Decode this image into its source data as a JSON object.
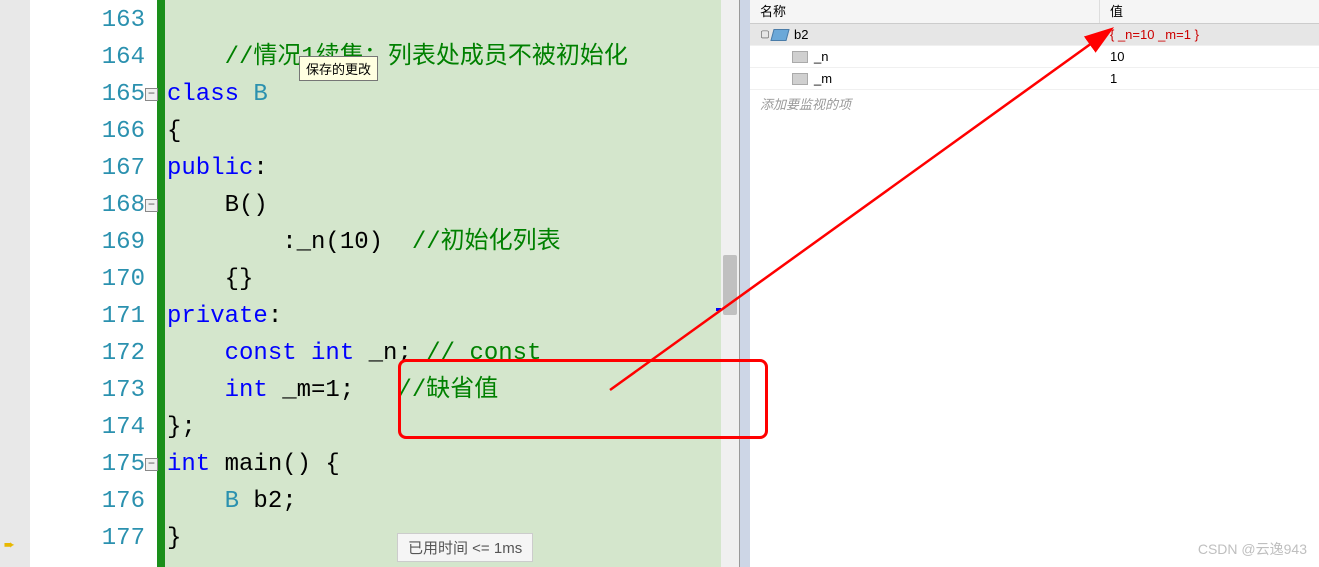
{
  "editor": {
    "tooltip": "保存的更改",
    "perf_tip": "已用时间 <= 1ms",
    "lines": [
      {
        "no": "163",
        "indent": "",
        "tokens": []
      },
      {
        "no": "164",
        "indent": "    ",
        "tokens": [
          {
            "t": "//情况1续集：列表处成员不被初始化",
            "cls": "c-comment"
          }
        ]
      },
      {
        "no": "165",
        "indent": "",
        "fold": true,
        "tokens": [
          {
            "t": "class ",
            "cls": "c-kw"
          },
          {
            "t": "B",
            "cls": "c-type"
          }
        ]
      },
      {
        "no": "166",
        "indent": "",
        "tokens": [
          {
            "t": "{",
            "cls": "c-text"
          }
        ]
      },
      {
        "no": "167",
        "indent": "",
        "tokens": [
          {
            "t": "public",
            "cls": "c-kw"
          },
          {
            "t": ":",
            "cls": "c-text"
          }
        ]
      },
      {
        "no": "168",
        "indent": "    ",
        "fold": true,
        "tokens": [
          {
            "t": "B()",
            "cls": "c-func"
          }
        ]
      },
      {
        "no": "169",
        "indent": "        ",
        "tokens": [
          {
            "t": ":_n(10)  ",
            "cls": "c-text"
          },
          {
            "t": "//初始化列表",
            "cls": "c-comment"
          }
        ]
      },
      {
        "no": "170",
        "indent": "    ",
        "tokens": [
          {
            "t": "{}",
            "cls": "c-text"
          }
        ]
      },
      {
        "no": "171",
        "indent": "",
        "tokens": [
          {
            "t": "private",
            "cls": "c-kw"
          },
          {
            "t": ":",
            "cls": "c-text"
          }
        ]
      },
      {
        "no": "172",
        "indent": "    ",
        "tokens": [
          {
            "t": "const int ",
            "cls": "c-kw"
          },
          {
            "t": "_n; ",
            "cls": "c-text"
          },
          {
            "t": "// const",
            "cls": "c-comment"
          }
        ]
      },
      {
        "no": "173",
        "indent": "    ",
        "tokens": [
          {
            "t": "int ",
            "cls": "c-kw"
          },
          {
            "t": "_m=1;   ",
            "cls": "c-text"
          },
          {
            "t": "//缺省值",
            "cls": "c-comment"
          }
        ]
      },
      {
        "no": "174",
        "indent": "",
        "tokens": [
          {
            "t": "};",
            "cls": "c-text"
          }
        ]
      },
      {
        "no": "175",
        "indent": "",
        "fold": true,
        "tokens": [
          {
            "t": "int ",
            "cls": "c-kw"
          },
          {
            "t": "main() {",
            "cls": "c-func"
          }
        ]
      },
      {
        "no": "176",
        "indent": "    ",
        "tokens": [
          {
            "t": "B ",
            "cls": "c-type"
          },
          {
            "t": "b2;",
            "cls": "c-text"
          }
        ]
      },
      {
        "no": "177",
        "indent": "",
        "tokens": [
          {
            "t": "}",
            "cls": "c-text"
          }
        ]
      }
    ]
  },
  "watch": {
    "header_name": "名称",
    "header_value": "值",
    "rows": [
      {
        "level": 0,
        "expand": "▢",
        "icon": "obj",
        "name": "b2",
        "value": "{ _n=10 _m=1 }",
        "err": true,
        "sel": true
      },
      {
        "level": 1,
        "expand": "",
        "icon": "lock",
        "name": "_n",
        "value": "10"
      },
      {
        "level": 1,
        "expand": "",
        "icon": "lock",
        "name": "_m",
        "value": "1"
      }
    ],
    "add_text": "添加要监视的项"
  },
  "watermark": "CSDN @云逸943",
  "colors": {
    "keyword": "#0000ff",
    "type": "#2b91af",
    "comment": "#008000",
    "error": "#cc0000",
    "highlight_bg": "#d4e6cc"
  }
}
